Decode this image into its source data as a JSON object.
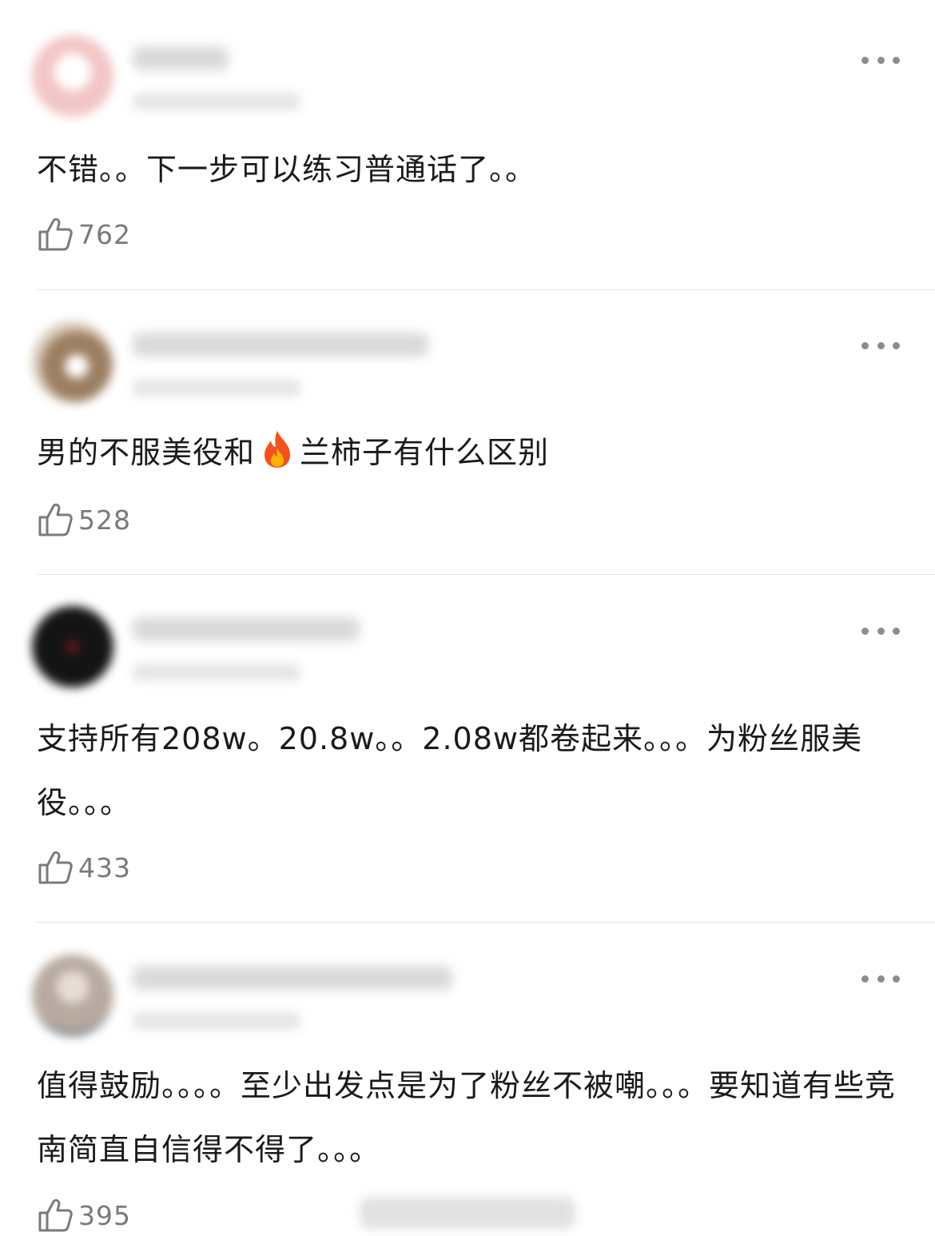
{
  "comments": [
    {
      "text": "不错。。下一步可以练习普通话了。。",
      "likes": "762",
      "avatar_color": "#f2c6c6"
    },
    {
      "text_before": "男的不服美役和",
      "text_after": "兰柿子有什么区别",
      "emoji": "fire-icon",
      "likes": "528",
      "avatar_color": "#9c7f62"
    },
    {
      "text": "支持所有208w。20.8w。。2.08w都卷起来。。。为粉丝服美役。。。",
      "likes": "433",
      "avatar_color": "#141414"
    },
    {
      "text": "值得鼓励。。。。至少出发点是为了粉丝不被嘲。。。要知道有些竞南简直自信得不得了。。。",
      "likes": "395",
      "avatar_color": "#b8aaa0"
    }
  ],
  "colors": {
    "text": "#1a1a1a",
    "meta": "#7a7a7a",
    "divider": "#e6e6e6"
  }
}
